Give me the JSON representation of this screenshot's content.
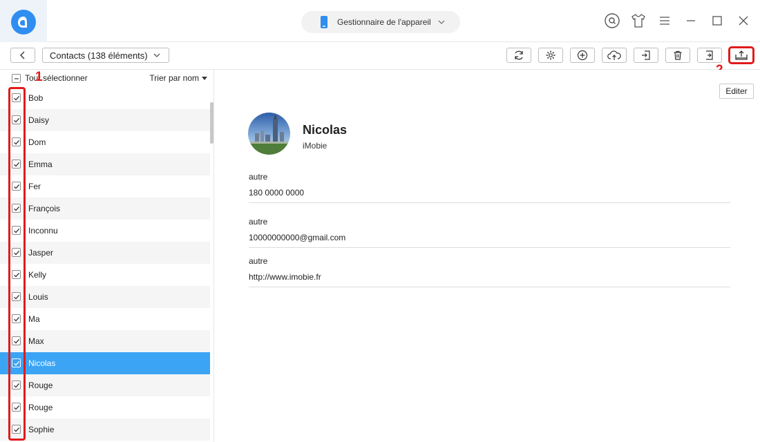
{
  "header": {
    "device_label": "Gestionnaire de l'appareil"
  },
  "toolbar": {
    "category_label": "Contacts (138 éléments)",
    "buttons": [
      {
        "name": "refresh-button",
        "icon": "refresh-icon"
      },
      {
        "name": "settings-button",
        "icon": "gear-icon"
      },
      {
        "name": "add-button",
        "icon": "plus-icon"
      },
      {
        "name": "cloud-upload-button",
        "icon": "cloud-upload-icon"
      },
      {
        "name": "import-button",
        "icon": "import-icon"
      },
      {
        "name": "delete-button",
        "icon": "trash-icon"
      },
      {
        "name": "transfer-button",
        "icon": "transfer-icon"
      },
      {
        "name": "export-to-computer-button",
        "icon": "export-icon"
      }
    ]
  },
  "list_header": {
    "select_all_label": "Tout sélectionner",
    "sort_label": "Trier par nom"
  },
  "contacts": [
    {
      "name": "Bob",
      "checked": true
    },
    {
      "name": "Daisy",
      "checked": true
    },
    {
      "name": "Dom",
      "checked": true
    },
    {
      "name": "Emma",
      "checked": true
    },
    {
      "name": "Fer",
      "checked": true
    },
    {
      "name": "François",
      "checked": true
    },
    {
      "name": "Inconnu",
      "checked": true
    },
    {
      "name": "Jasper",
      "checked": true
    },
    {
      "name": "Kelly",
      "checked": true
    },
    {
      "name": "Louis",
      "checked": true
    },
    {
      "name": "Ma",
      "checked": true
    },
    {
      "name": "Max",
      "checked": true
    },
    {
      "name": "Nicolas",
      "checked": true,
      "selected": true
    },
    {
      "name": "Rouge",
      "checked": true
    },
    {
      "name": "Rouge",
      "checked": true
    },
    {
      "name": "Sophie",
      "checked": true
    }
  ],
  "annotations": {
    "marker_1": "1",
    "marker_2": "2"
  },
  "detail": {
    "edit_label": "Editer",
    "name": "Nicolas",
    "company": "iMobie",
    "fields": [
      {
        "label": "autre",
        "value": "180 0000 0000"
      },
      {
        "label": "autre",
        "value": "10000000000@gmail.com"
      },
      {
        "label": "autre",
        "value": "http://www.imobie.fr"
      }
    ]
  },
  "colors": {
    "accent": "#3ba4f5",
    "highlight": "#e01b1b",
    "brand": "#2f8ef0"
  }
}
